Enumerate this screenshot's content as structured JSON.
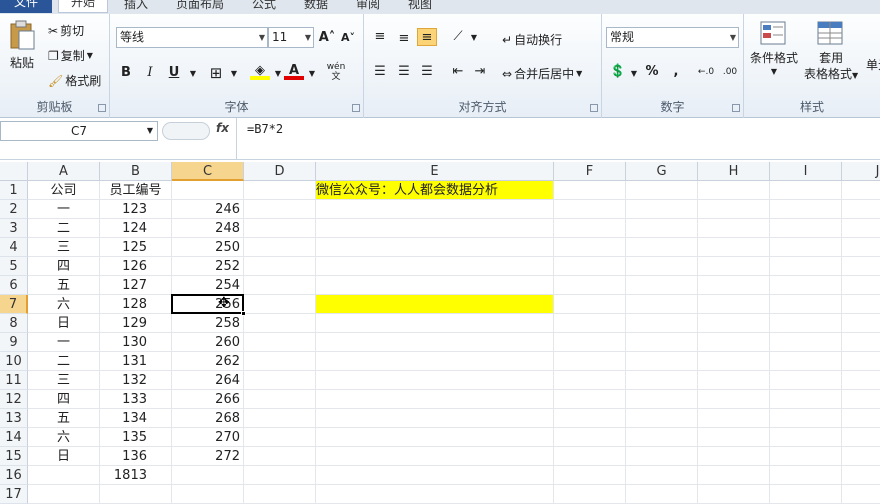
{
  "ribbon_tabs": [
    "文件",
    "开始",
    "插入",
    "页面布局",
    "公式",
    "数据",
    "审阅",
    "视图"
  ],
  "clipboard": {
    "paste": "粘贴",
    "cut": "剪切",
    "copy": "复制",
    "format_painter": "格式刷",
    "label": "剪贴板"
  },
  "font": {
    "name": "等线",
    "size": "11",
    "bold": "B",
    "italic": "I",
    "underline": "U",
    "wen": "wén",
    "label": "字体"
  },
  "alignment": {
    "wrap_text": "自动换行",
    "merge_center": "合并后居中",
    "label": "对齐方式"
  },
  "number": {
    "format": "常规",
    "percent": "%",
    "comma": ",",
    "label": "数字"
  },
  "styles": {
    "conditional": "条件格式",
    "table_line1": "套用",
    "table_line2": "表格格式",
    "cell_style": "单元",
    "label": "样式"
  },
  "namebox": "C7",
  "formula": "=B7*2",
  "fx": "fx",
  "columns": [
    "A",
    "B",
    "C",
    "D",
    "E",
    "F",
    "G",
    "H",
    "I",
    "J"
  ],
  "selected_column": "C",
  "selected_row": 7,
  "rows": [
    {
      "n": "1",
      "a": "公司",
      "b": "员工编号",
      "c": "",
      "e": "微信公众号：人人都会数据分析"
    },
    {
      "n": "2",
      "a": "一",
      "b": "123",
      "c": "246",
      "e": ""
    },
    {
      "n": "3",
      "a": "二",
      "b": "124",
      "c": "248",
      "e": ""
    },
    {
      "n": "4",
      "a": "三",
      "b": "125",
      "c": "250",
      "e": ""
    },
    {
      "n": "5",
      "a": "四",
      "b": "126",
      "c": "252",
      "e": ""
    },
    {
      "n": "6",
      "a": "五",
      "b": "127",
      "c": "254",
      "e": ""
    },
    {
      "n": "7",
      "a": "六",
      "b": "128",
      "c": "256",
      "e": ""
    },
    {
      "n": "8",
      "a": "日",
      "b": "129",
      "c": "258",
      "e": ""
    },
    {
      "n": "9",
      "a": "一",
      "b": "130",
      "c": "260",
      "e": ""
    },
    {
      "n": "10",
      "a": "二",
      "b": "131",
      "c": "262",
      "e": ""
    },
    {
      "n": "11",
      "a": "三",
      "b": "132",
      "c": "264",
      "e": ""
    },
    {
      "n": "12",
      "a": "四",
      "b": "133",
      "c": "266",
      "e": ""
    },
    {
      "n": "13",
      "a": "五",
      "b": "134",
      "c": "268",
      "e": ""
    },
    {
      "n": "14",
      "a": "六",
      "b": "135",
      "c": "270",
      "e": ""
    },
    {
      "n": "15",
      "a": "日",
      "b": "136",
      "c": "272",
      "e": ""
    },
    {
      "n": "16",
      "a": "",
      "b": "1813",
      "c": "",
      "e": ""
    },
    {
      "n": "17",
      "a": "",
      "b": "",
      "c": "",
      "e": ""
    }
  ],
  "colors": {
    "highlight": "#ffff00",
    "selection": "#f6d58f",
    "file_tab": "#2a5699"
  }
}
